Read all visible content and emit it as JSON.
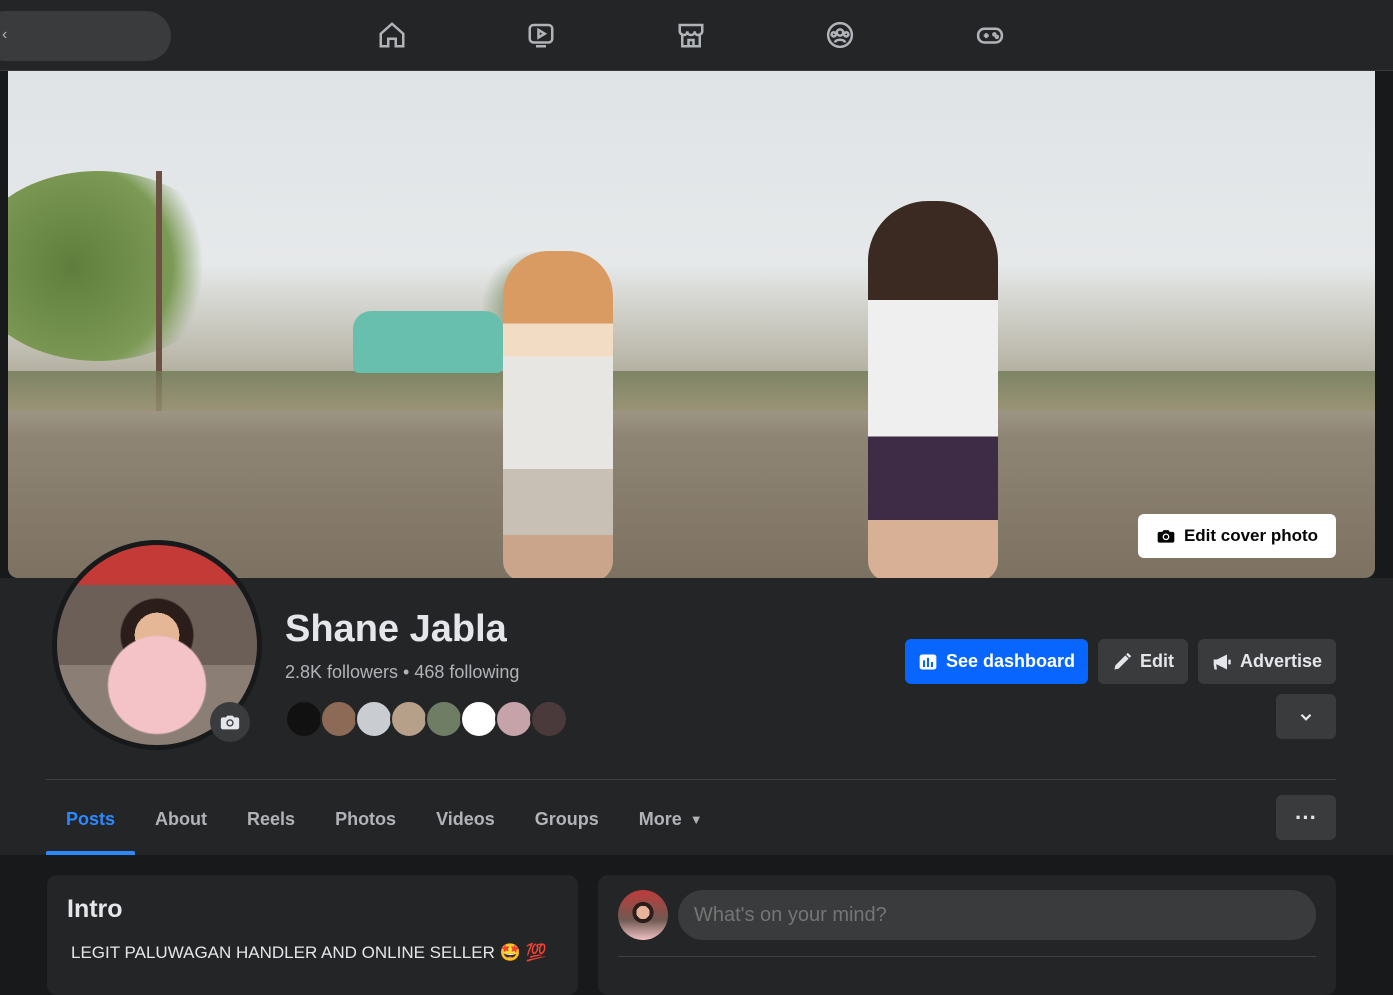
{
  "topbar": {
    "back_glyph": "‹",
    "nav_icons": [
      "home-icon",
      "video-icon",
      "marketplace-icon",
      "groups-icon",
      "gaming-icon"
    ]
  },
  "cover": {
    "edit_label": "Edit cover photo"
  },
  "profile": {
    "name": "Shane Jabla",
    "stats": "2.8K followers • 468 following",
    "friend_avatar_colors": [
      "#111111",
      "#8c6a56",
      "#c9ccd1",
      "#b7a08a",
      "#6e7d63",
      "#ffffff",
      "#c6a3a8",
      "#4b3a3c"
    ]
  },
  "actions": {
    "dashboard_label": "See dashboard",
    "edit_label": "Edit",
    "advertise_label": "Advertise"
  },
  "tabs": [
    {
      "label": "Posts",
      "active": true
    },
    {
      "label": "About"
    },
    {
      "label": "Reels"
    },
    {
      "label": "Photos"
    },
    {
      "label": "Videos"
    },
    {
      "label": "Groups"
    },
    {
      "label": "More",
      "caret": "▼"
    }
  ],
  "more_menu": "···",
  "intro": {
    "title": "Intro",
    "bio": "LEGIT PALUWAGAN HANDLER AND ONLINE SELLER 🤩 💯"
  },
  "composer": {
    "placeholder": "What's on your mind?"
  },
  "colors": {
    "accent": "#0866ff",
    "active_tab": "#2d88ff",
    "surface": "#242526",
    "background": "#18191a"
  }
}
